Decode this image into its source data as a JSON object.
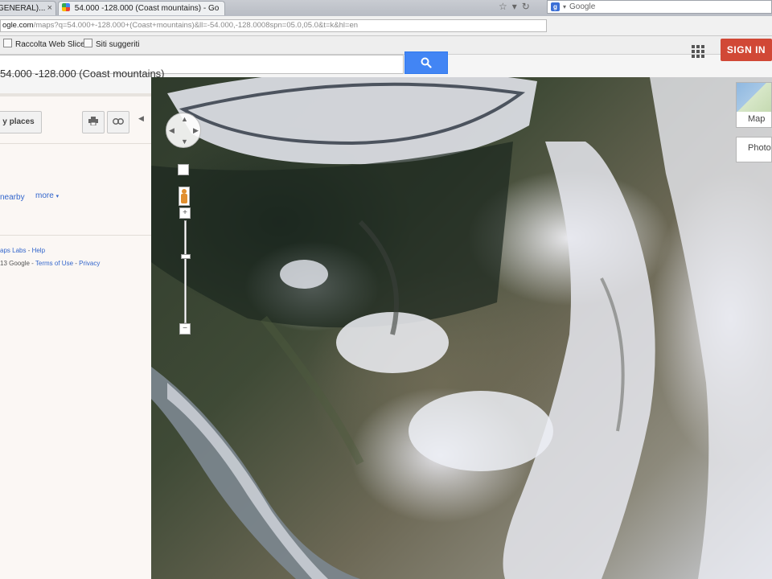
{
  "browser": {
    "tabs": [
      {
        "title": "GENERAL)...",
        "active": false
      },
      {
        "title": "54.000 -128.000 (Coast mountains) - Go",
        "active": true
      }
    ],
    "search_engine": "Google",
    "url_domain": "ogle.com",
    "url_path": "/maps?q=54.000+-128.000+(Coast+mountains)&ll=-54.000,-128.0008spn=05.0,05.0&t=k&hl=en",
    "bookmarks": [
      "Raccolta Web Slice",
      "Siti suggeriti"
    ]
  },
  "maps": {
    "query_title": "54.000 -128.000 (Coast mountains)",
    "sign_in_label": "SIGN IN",
    "colors": {
      "search_button": "#4285f4",
      "sign_in": "#d14836",
      "link": "#3366cc"
    },
    "left_panel": {
      "my_places_label": "y places",
      "nearby_label": "nearby",
      "more_label": "more",
      "footer1_labs": "aps Labs",
      "footer1_help": "Help",
      "footer2_copy": "13 Google",
      "footer2_terms": "Terms of Use",
      "footer2_privacy": "Privacy"
    },
    "map_type": {
      "map_label": "Map",
      "photo_label": "Photo"
    }
  }
}
